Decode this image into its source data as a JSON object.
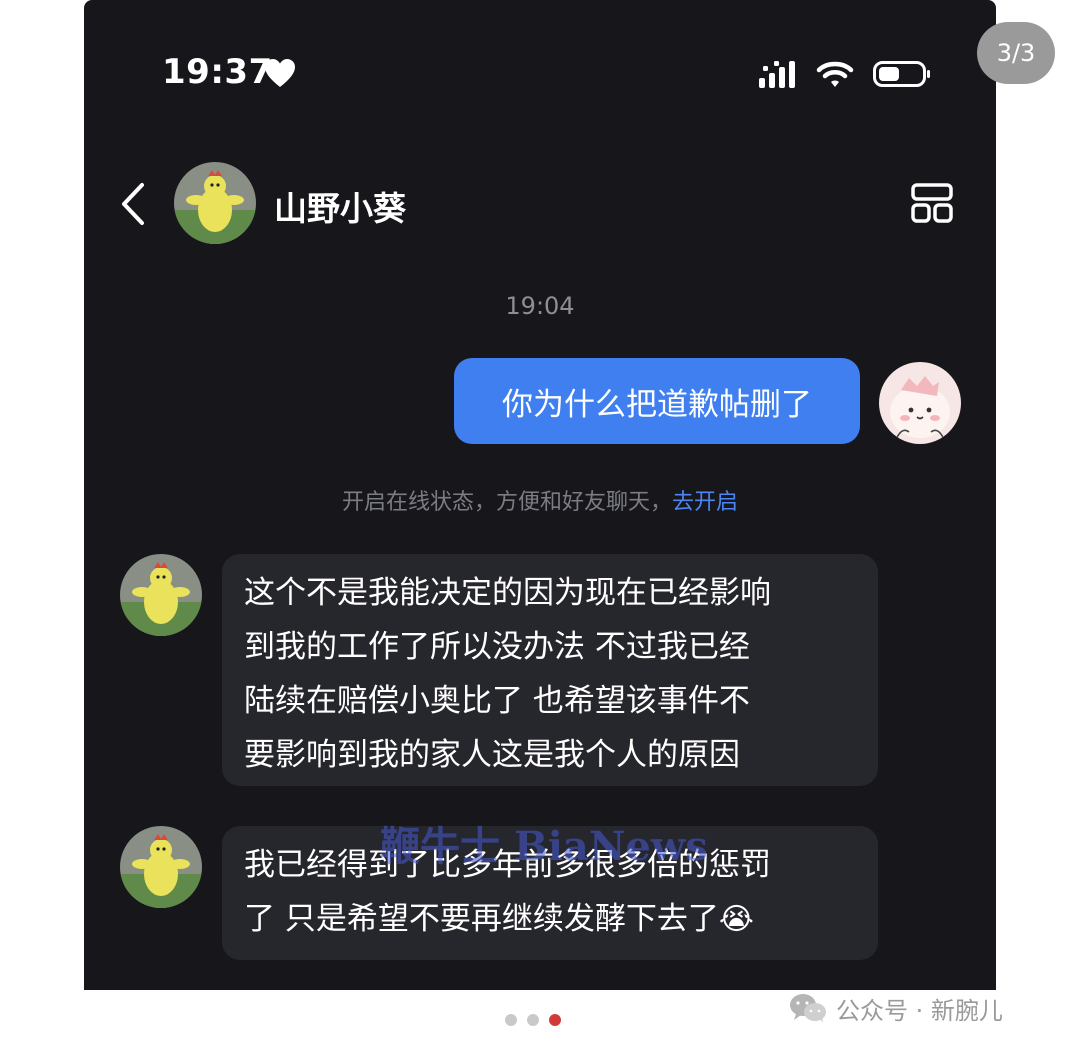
{
  "pager": {
    "label": "3/3"
  },
  "status_bar": {
    "time": "19:37",
    "heart_icon": "heart-icon",
    "signal_icon": "signal-icon",
    "wifi_icon": "wifi-icon",
    "battery_icon": "battery-icon"
  },
  "header": {
    "back_icon": "chevron-left-icon",
    "contact_name": "山野小葵",
    "menu_icon": "grid-layout-icon"
  },
  "chat": {
    "timestamp": "19:04",
    "outgoing": [
      {
        "text": "你为什么把道歉帖删了"
      }
    ],
    "notice": {
      "text": "开启在线状态，方便和好友聊天，",
      "link": "去开启"
    },
    "incoming": [
      {
        "lines": [
          "这个不是我能决定的因为现在已经影响",
          "到我的工作了所以没办法 不过我已经",
          "陆续在赔偿小奥比了 也希望该事件不",
          "要影响到我的家人这是我个人的原因"
        ]
      },
      {
        "lines": [
          "我已经得到了比多年前多很多倍的惩罚",
          "了 只是希望不要再继续发酵下去了"
        ],
        "emoji": "😭"
      }
    ]
  },
  "watermark": "鞭牛士 BiaNews",
  "carousel": {
    "count": 3,
    "active_index": 2
  },
  "footer": {
    "icon": "wechat-icon",
    "text": "公众号 · 新腕儿"
  },
  "colors": {
    "background": "#16161b",
    "outgoing_bubble": "#3f7ff0",
    "incoming_bubble": "#26262d",
    "link": "#4d86f2"
  }
}
